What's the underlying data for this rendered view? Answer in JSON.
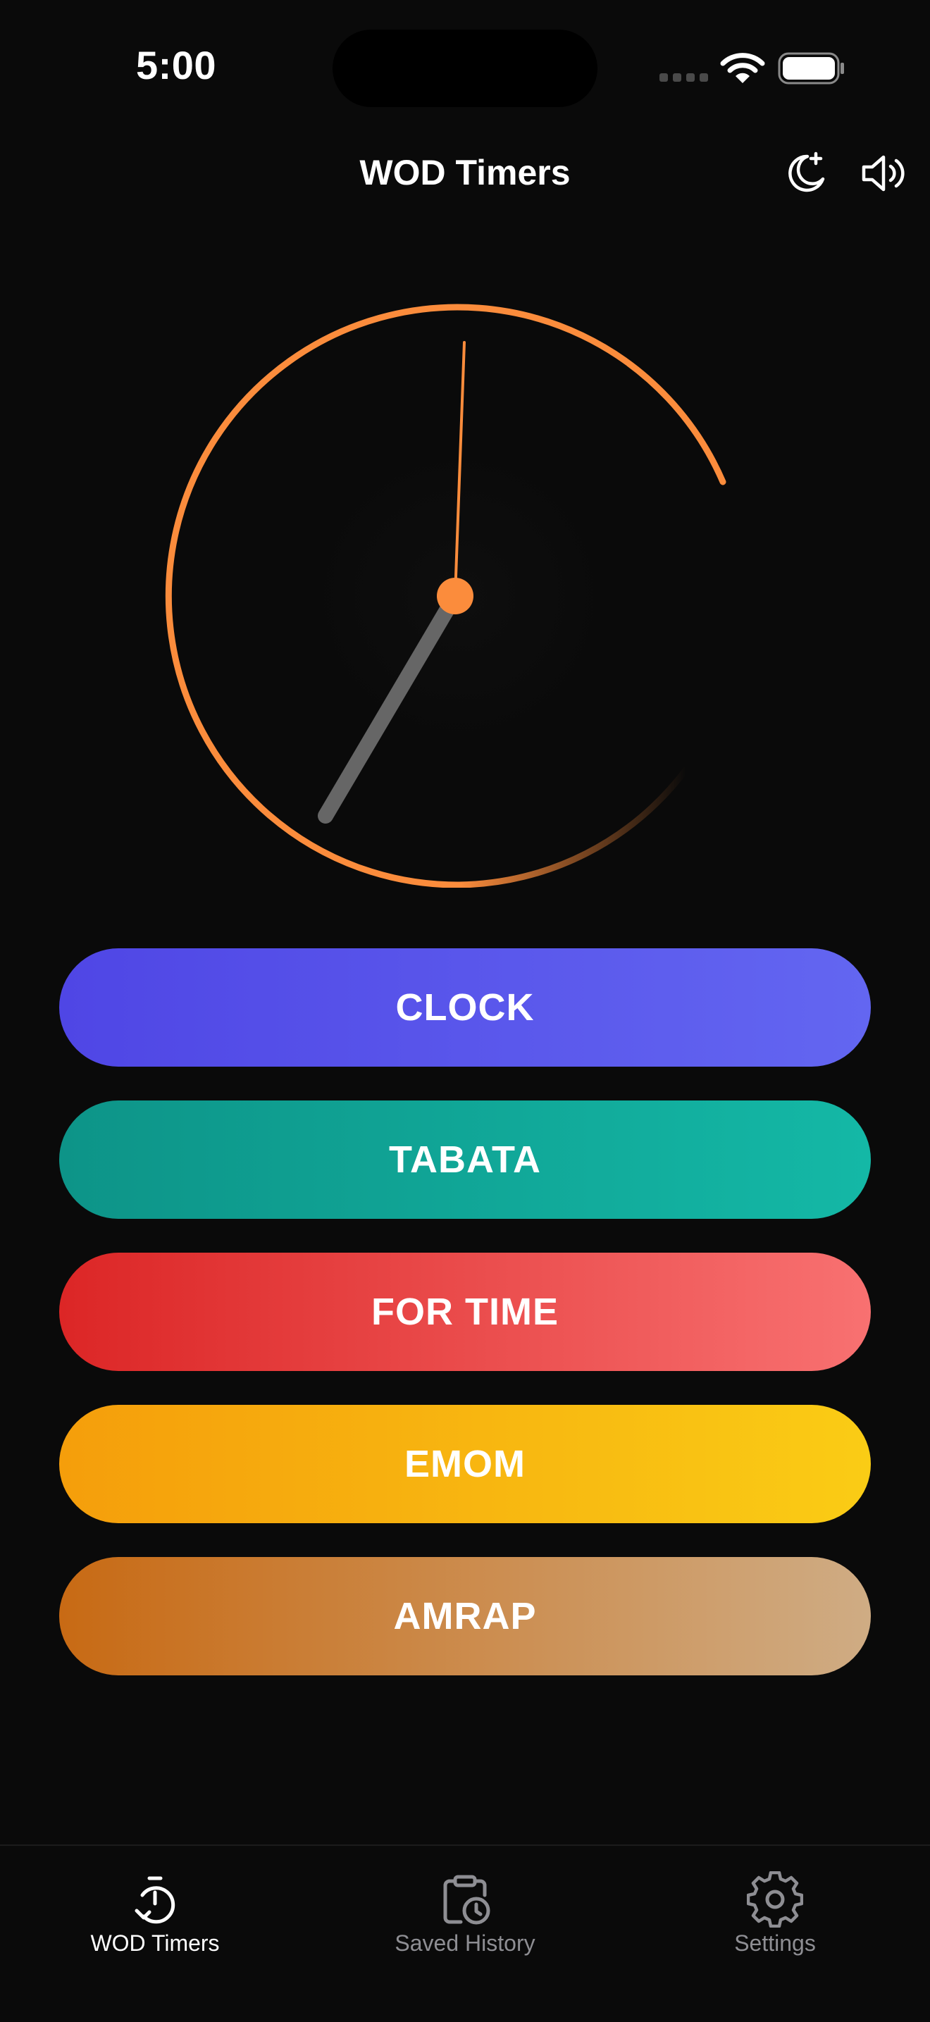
{
  "status_bar": {
    "time": "5:00"
  },
  "header": {
    "title": "WOD Timers",
    "icons": [
      "moon-plus-icon",
      "speaker-icon"
    ]
  },
  "clock": {
    "accent_color": "#fb8c3c",
    "hand_color": "#666666"
  },
  "timers": [
    {
      "label": "CLOCK",
      "colors": [
        "#4f46e5",
        "#6366f1"
      ]
    },
    {
      "label": "TABATA",
      "colors": [
        "#0d9488",
        "#14b8a6"
      ]
    },
    {
      "label": "FOR TIME",
      "colors": [
        "#dc2626",
        "#f87171"
      ]
    },
    {
      "label": "EMOM",
      "colors": [
        "#f59e0b",
        "#facc15"
      ]
    },
    {
      "label": "AMRAP",
      "colors": [
        "#c86a14",
        "#cfac84"
      ]
    }
  ],
  "tab_bar": {
    "items": [
      {
        "label": "WOD Timers",
        "icon": "stopwatch-icon",
        "active": true
      },
      {
        "label": "Saved History",
        "icon": "clipboard-clock-icon",
        "active": false
      },
      {
        "label": "Settings",
        "icon": "gear-icon",
        "active": false
      }
    ]
  }
}
